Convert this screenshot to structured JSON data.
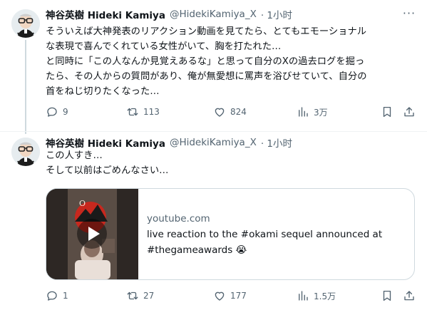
{
  "tweets": [
    {
      "author_name": "神谷英樹 Hideki Kamiya",
      "handle": "@HidekiKamiya_X",
      "time": "· 1小时",
      "lines": [
        "そういえば大神発表のリアクション動画を見てたら、とてもエモーショナル",
        "な表現で喜んでくれている女性がいて、胸を打たれた…",
        "と同時に「この人なんか見覚えあるな」と思って自分のXの過去ログを掘っ",
        "たら、その人からの質問があり、俺が無愛想に罵声を浴びせていて、自分の",
        "首をねじ切りたくなった…"
      ],
      "replies": "9",
      "reposts": "113",
      "likes": "824",
      "views": "3万"
    },
    {
      "author_name": "神谷英樹 Hideki Kamiya",
      "handle": "@HidekiKamiya_X",
      "time": "· 1小时",
      "lines": [
        "この人すき…",
        "そして以前はごめんなさい…"
      ],
      "card": {
        "domain": "youtube.com",
        "title_line1": "live reaction to the #okami sequel announced at",
        "title_line2": "#thegameawards 😭"
      },
      "replies": "1",
      "reposts": "27",
      "likes": "177",
      "views": "1.5万"
    }
  ],
  "icons": {
    "more": "more-horizontal-icon",
    "reply": "reply-bubble-icon",
    "repost": "repost-arrows-icon",
    "like": "heart-icon",
    "views": "bar-chart-icon",
    "bookmark": "bookmark-icon",
    "share": "share-upload-icon",
    "play": "play-icon"
  },
  "colors": {
    "text": "#0f1419",
    "secondary": "#536471",
    "border": "#cfd9de",
    "thread_line": "#cfd9de"
  }
}
